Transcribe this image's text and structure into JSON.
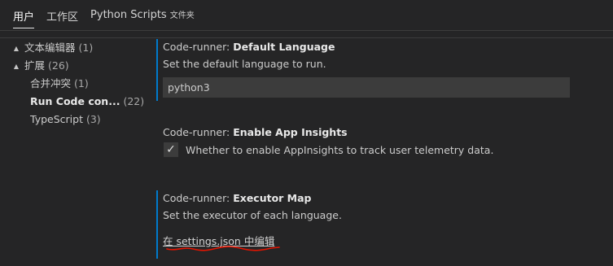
{
  "tabs": [
    {
      "label": "用户",
      "active": true
    },
    {
      "label": "工作区",
      "active": false
    },
    {
      "label": "Python Scripts",
      "sub": "文件夹",
      "active": false
    }
  ],
  "tree": {
    "items": [
      {
        "label": "文本编辑器",
        "count": "(1)",
        "twisty": "▲"
      },
      {
        "label": "扩展",
        "count": "(26)",
        "twisty": "▲"
      },
      {
        "label": "合并冲突",
        "count": "(1)"
      },
      {
        "label": "Run Code con...",
        "count": "(22)"
      },
      {
        "label": "TypeScript",
        "count": "(3)"
      }
    ]
  },
  "settings": {
    "default_language": {
      "category": "Code-runner: ",
      "key": "Default Language",
      "description": "Set the default language to run.",
      "value": "python3"
    },
    "enable_app_insights": {
      "category": "Code-runner: ",
      "key": "Enable App Insights",
      "checked": true,
      "check_glyph": "✓",
      "description": "Whether to enable AppInsights to track user telemetry data."
    },
    "executor_map": {
      "category": "Code-runner: ",
      "key": "Executor Map",
      "description": "Set the executor of each language.",
      "link_text": "在 settings.json 中编辑"
    }
  },
  "colors": {
    "background": "#252526",
    "focus_border": "#007acc",
    "input_background": "#3c3c3c",
    "annotation": "#e51400"
  }
}
